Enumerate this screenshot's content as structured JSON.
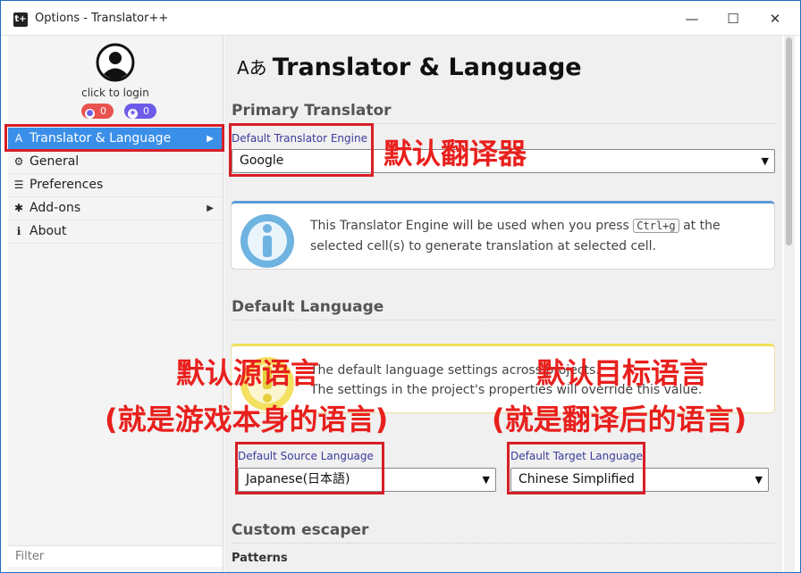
{
  "window": {
    "title": "Options - Translator++",
    "app_icon": "t+",
    "minimize": "—",
    "maximize": "☐",
    "close": "✕"
  },
  "user": {
    "login_text": "click to login",
    "red_badge_count": "0",
    "purple_badge_count": "0"
  },
  "nav": {
    "items": [
      {
        "label": "Translator & Language",
        "icon": "translate-icon",
        "glyph": "Aあ",
        "arrow": "▶",
        "active": true
      },
      {
        "label": "General",
        "icon": "gear-icon",
        "glyph": "⚙"
      },
      {
        "label": "Preferences",
        "icon": "sliders-icon",
        "glyph": "☰"
      },
      {
        "label": "Add-ons",
        "icon": "puzzle-icon",
        "glyph": "✱",
        "arrow": "▶"
      },
      {
        "label": "About",
        "icon": "info-icon",
        "glyph": "ℹ"
      }
    ],
    "filter_placeholder": "Filter"
  },
  "page": {
    "title": "Translator & Language",
    "title_icon_glyph": "Aあ",
    "primary_section": "Primary Translator",
    "engine_label": "Default Translator Engine",
    "engine_value": "Google",
    "engine_info_a": "This Translator Engine will be used when you press ",
    "engine_info_key": "Ctrl+g",
    "engine_info_b": " at the selected cell(s) to generate translation at selected cell.",
    "language_section": "Default Language",
    "lang_info_1": "The default language settings across projects.",
    "lang_info_2": "The settings in the project's properties will override this value.",
    "source_label": "Default Source Language",
    "source_value": "Japanese(日本語)",
    "target_label": "Default Target Language",
    "target_value": "Chinese Simplified",
    "escaper_section": "Custom escaper",
    "patterns_label": "Patterns"
  },
  "annotations": {
    "engine": "默认翻译器",
    "source_line1": "默认源语言",
    "source_line2": "(就是游戏本身的语言)",
    "target_line1": "默认目标语言",
    "target_line2": "(就是翻译后的语言)"
  },
  "colors": {
    "accent": "#3a8fe8",
    "annotation_red": "#e8201d",
    "info_border": "#5b9bd5",
    "warning_border": "#f1e05a"
  }
}
